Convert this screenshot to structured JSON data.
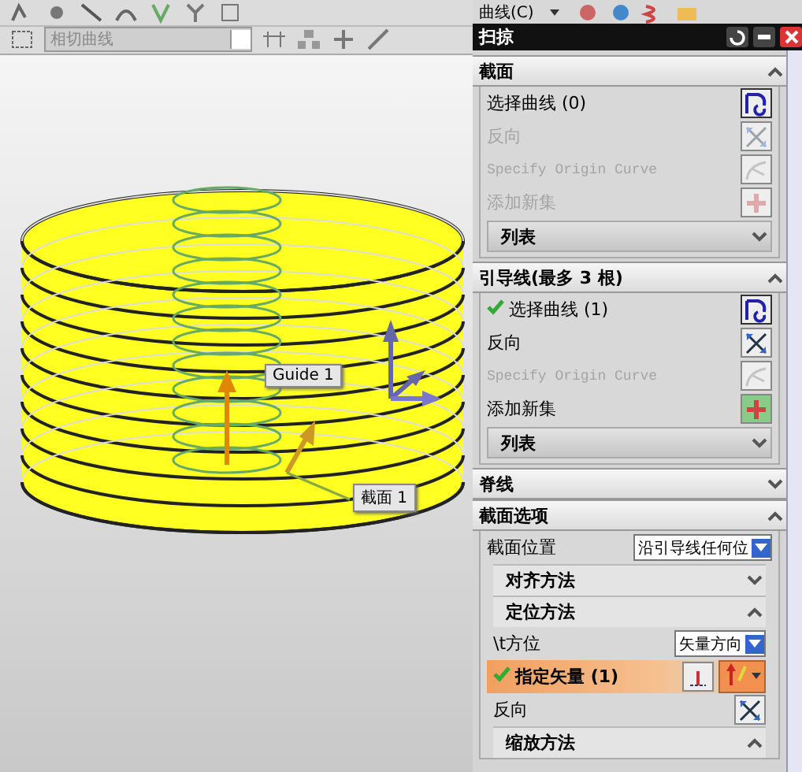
{
  "toolbar": {
    "menu": "曲线(C)",
    "curve_rule": "相切曲线"
  },
  "viewport": {
    "labels": [
      {
        "kind": "guide",
        "text": "Guide 1"
      },
      {
        "kind": "section",
        "text": "截面 1"
      }
    ]
  },
  "dialog": {
    "title": "扫掠",
    "sections": [
      {
        "title": "截面",
        "expanded": true,
        "rows": [
          {
            "kind": "select-curve",
            "label": "选择曲线 (0)",
            "done": false,
            "disabled": false
          },
          {
            "kind": "reverse",
            "label": "反向",
            "disabled": true
          },
          {
            "kind": "origin-curve",
            "label": "Specify Origin Curve",
            "disabled": true
          },
          {
            "kind": "add-set",
            "label": "添加新集",
            "disabled": true
          },
          {
            "kind": "list",
            "label": "列表",
            "expanded": false
          }
        ]
      },
      {
        "title": "引导线(最多 3 根)",
        "expanded": true,
        "rows": [
          {
            "kind": "select-curve",
            "label": "选择曲线 (1)",
            "done": true,
            "disabled": false
          },
          {
            "kind": "reverse",
            "label": "反向",
            "disabled": false
          },
          {
            "kind": "origin-curve",
            "label": "Specify Origin Curve",
            "disabled": true
          },
          {
            "kind": "add-set",
            "label": "添加新集",
            "disabled": false
          },
          {
            "kind": "list",
            "label": "列表",
            "expanded": false
          }
        ]
      },
      {
        "title": "脊线",
        "expanded": false
      },
      {
        "title": "截面选项",
        "expanded": true,
        "rows": [
          {
            "kind": "dropdown",
            "label": "截面位置",
            "value": "沿引导线任何位"
          },
          {
            "kind": "group",
            "label": "对齐方法",
            "expanded": false
          },
          {
            "kind": "group",
            "label": "定位方法",
            "expanded": true,
            "rows": [
              {
                "kind": "dropdown",
                "label": "\\t方位",
                "value": "矢量方向"
              },
              {
                "kind": "vector",
                "label": "指定矢量 (1)",
                "done": true,
                "highlighted": true
              },
              {
                "kind": "reverse",
                "label": "反向",
                "disabled": false
              }
            ]
          },
          {
            "kind": "group",
            "label": "缩放方法",
            "expanded": true
          }
        ]
      }
    ]
  }
}
